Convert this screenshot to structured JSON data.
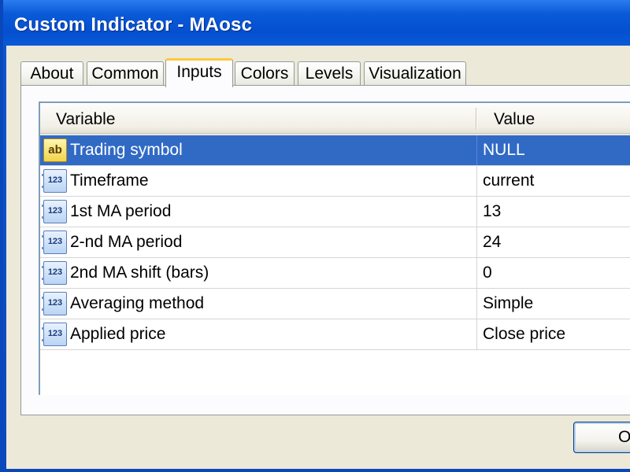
{
  "window": {
    "title": "Custom Indicator - MAosc"
  },
  "tabs": [
    {
      "label": "About"
    },
    {
      "label": "Common"
    },
    {
      "label": "Inputs"
    },
    {
      "label": "Colors"
    },
    {
      "label": "Levels"
    },
    {
      "label": "Visualization"
    }
  ],
  "active_tab": "Inputs",
  "grid": {
    "headers": {
      "variable": "Variable",
      "value": "Value"
    },
    "rows": [
      {
        "name": "Trading symbol",
        "value": "NULL",
        "icon": "ab",
        "selected": true
      },
      {
        "name": "Timeframe",
        "value": "current",
        "icon": "123",
        "selected": false
      },
      {
        "name": "1st MA period",
        "value": "13",
        "icon": "123",
        "selected": false
      },
      {
        "name": "2-nd MA period",
        "value": "24",
        "icon": "123",
        "selected": false
      },
      {
        "name": "2nd MA shift (bars)",
        "value": "0",
        "icon": "123",
        "selected": false
      },
      {
        "name": "Averaging method",
        "value": "Simple",
        "icon": "123",
        "selected": false
      },
      {
        "name": "Applied price",
        "value": "Close price",
        "icon": "123",
        "selected": false
      }
    ]
  },
  "buttons": {
    "ok_label": "OK"
  }
}
